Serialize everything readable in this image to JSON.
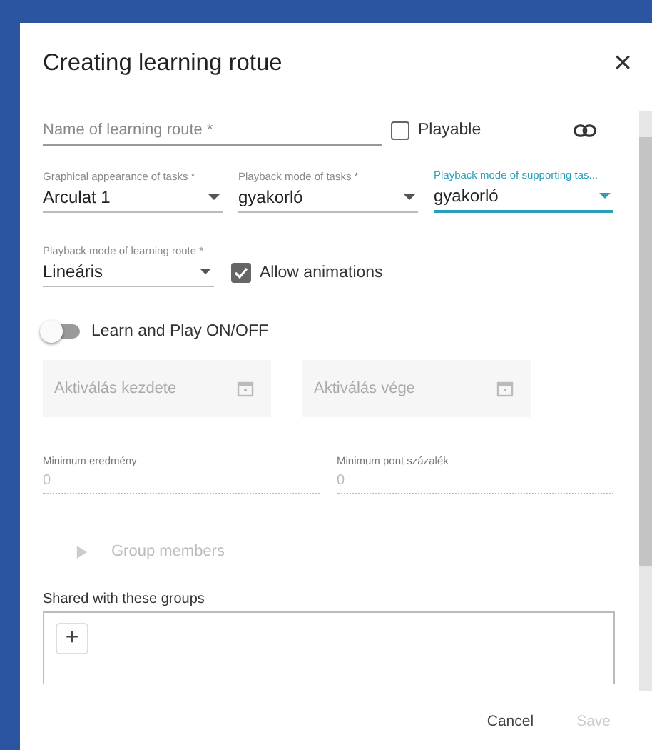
{
  "dialog": {
    "title": "Creating learning rotue",
    "close": "×"
  },
  "name_field": {
    "placeholder": "Name of learning route *"
  },
  "playable": {
    "label": "Playable",
    "checked": false
  },
  "selects": [
    {
      "label": "Graphical appearance of tasks *",
      "value": "Arculat 1",
      "focused": false
    },
    {
      "label": "Playback mode of tasks *",
      "value": "gyakorló",
      "focused": false
    },
    {
      "label": "Playback mode of supporting tas...",
      "value": "gyakorló",
      "focused": true
    }
  ],
  "route_mode": {
    "label": "Playback mode of learning route *",
    "value": "Lineáris"
  },
  "allow_animations": {
    "label": "Allow animations",
    "checked": true
  },
  "learn_play": {
    "label": "Learn and Play ON/OFF",
    "on": false
  },
  "date_fields": [
    {
      "placeholder": "Aktiválás kezdete"
    },
    {
      "placeholder": "Aktiválás vége"
    }
  ],
  "number_fields": [
    {
      "label": "Minimum eredmény",
      "value": "0"
    },
    {
      "label": "Minimum pont százalék",
      "value": "0"
    }
  ],
  "group_members": {
    "label": "Group members",
    "expanded": false
  },
  "shared": {
    "label": "Shared with these groups",
    "add": "+"
  },
  "buttons": [
    {
      "label": "Cancel",
      "disabled": false
    },
    {
      "label": "Save",
      "disabled": true
    }
  ]
}
